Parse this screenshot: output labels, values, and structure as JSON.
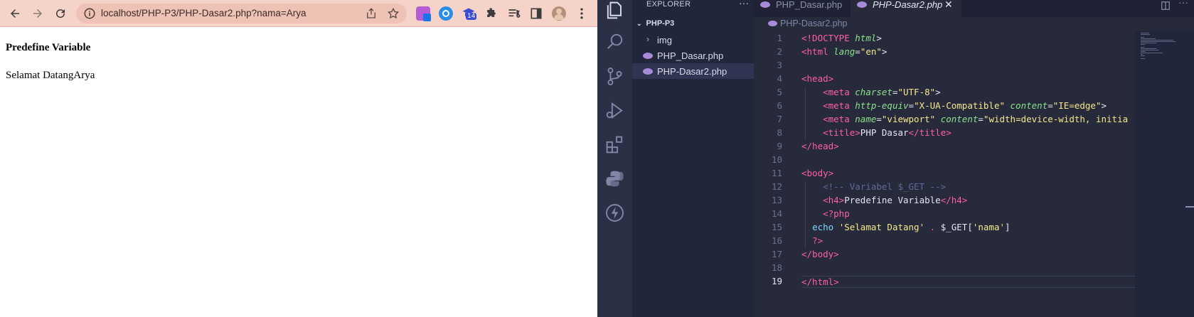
{
  "browser": {
    "url": "localhost/PHP-P3/PHP-Dasar2.php?nama=Arya",
    "ext_badge": "14",
    "page": {
      "heading": "Predefine Variable",
      "text": "Selamat DatangArya"
    },
    "icons": [
      "back-arrow-icon",
      "forward-arrow-icon",
      "reload-icon",
      "info-icon",
      "share-icon",
      "star-icon",
      "extension-icon",
      "puzzle-icon",
      "media-icon",
      "sidepanel-icon",
      "avatar",
      "menu-icon"
    ]
  },
  "vscode": {
    "explorer_title": "EXPLORER",
    "explorer_more": "···",
    "project": "PHP-P3",
    "tree": [
      {
        "label": "img",
        "type": "folder"
      },
      {
        "label": "PHP_Dasar.php",
        "type": "file"
      },
      {
        "label": "PHP-Dasar2.php",
        "type": "file"
      }
    ],
    "tabs": [
      {
        "label": "PHP_Dasar.php",
        "active": false
      },
      {
        "label": "PHP-Dasar2.php",
        "active": true
      }
    ],
    "close_glyph": "✕",
    "breadcrumb": "PHP-Dasar2.php",
    "current_line": 19,
    "line_numbers": [
      "1",
      "2",
      "3",
      "4",
      "5",
      "6",
      "7",
      "8",
      "9",
      "10",
      "11",
      "12",
      "13",
      "14",
      "15",
      "16",
      "17",
      "18",
      "19"
    ],
    "code_lines": [
      [
        {
          "t": "<!DOCTYPE ",
          "c": "tag"
        },
        {
          "t": "html",
          "c": "attr"
        },
        {
          "t": ">",
          "c": "punc"
        }
      ],
      [
        {
          "t": "<html ",
          "c": "tag"
        },
        {
          "t": "lang",
          "c": "attr"
        },
        {
          "t": "=",
          "c": "punc"
        },
        {
          "t": "\"en\"",
          "c": "str"
        },
        {
          "t": ">",
          "c": "punc"
        }
      ],
      [],
      [
        {
          "t": "<head>",
          "c": "tag"
        }
      ],
      [
        {
          "t": "    "
        },
        {
          "t": "<meta ",
          "c": "tag"
        },
        {
          "t": "charset",
          "c": "attr"
        },
        {
          "t": "=",
          "c": "punc"
        },
        {
          "t": "\"UTF-8\"",
          "c": "str"
        },
        {
          "t": ">",
          "c": "punc"
        }
      ],
      [
        {
          "t": "    "
        },
        {
          "t": "<meta ",
          "c": "tag"
        },
        {
          "t": "http-equiv",
          "c": "attr"
        },
        {
          "t": "=",
          "c": "punc"
        },
        {
          "t": "\"X-UA-Compatible\"",
          "c": "str"
        },
        {
          "t": " "
        },
        {
          "t": "content",
          "c": "attr"
        },
        {
          "t": "=",
          "c": "punc"
        },
        {
          "t": "\"IE=edge\"",
          "c": "str"
        },
        {
          "t": ">",
          "c": "punc"
        }
      ],
      [
        {
          "t": "    "
        },
        {
          "t": "<meta ",
          "c": "tag"
        },
        {
          "t": "name",
          "c": "attr"
        },
        {
          "t": "=",
          "c": "punc"
        },
        {
          "t": "\"viewport\"",
          "c": "str"
        },
        {
          "t": " "
        },
        {
          "t": "content",
          "c": "attr"
        },
        {
          "t": "=",
          "c": "punc"
        },
        {
          "t": "\"width=device-width, initia",
          "c": "str"
        }
      ],
      [
        {
          "t": "    "
        },
        {
          "t": "<title>",
          "c": "tag"
        },
        {
          "t": "PHP Dasar",
          "c": "punc"
        },
        {
          "t": "</title>",
          "c": "tag"
        }
      ],
      [
        {
          "t": "</head>",
          "c": "tag"
        }
      ],
      [],
      [
        {
          "t": "<body>",
          "c": "tag"
        }
      ],
      [
        {
          "t": "    "
        },
        {
          "t": "<!-- Variabel $_GET -->",
          "c": "com"
        }
      ],
      [
        {
          "t": "    "
        },
        {
          "t": "<h4>",
          "c": "tag"
        },
        {
          "t": "Predefine Variable",
          "c": "punc"
        },
        {
          "t": "</h4>",
          "c": "tag"
        }
      ],
      [
        {
          "t": "    "
        },
        {
          "t": "<?php",
          "c": "tag"
        }
      ],
      [
        {
          "t": "  "
        },
        {
          "t": "echo ",
          "c": "kw"
        },
        {
          "t": "'Selamat Datang'",
          "c": "str"
        },
        {
          "t": " . ",
          "c": "op"
        },
        {
          "t": "$_GET",
          "c": "var"
        },
        {
          "t": "[",
          "c": "punc"
        },
        {
          "t": "'nama'",
          "c": "str"
        },
        {
          "t": "]",
          "c": "punc"
        }
      ],
      [
        {
          "t": "  "
        },
        {
          "t": "?>",
          "c": "tag"
        }
      ],
      [
        {
          "t": "</body>",
          "c": "tag"
        }
      ],
      [],
      [
        {
          "t": "</html>",
          "c": "tag"
        }
      ]
    ],
    "colors": {
      "editor_bg": "#262a3b",
      "tag": "#ff5fa2",
      "attr": "#8be28b",
      "string": "#f7e78a",
      "comment": "#5f6a9a",
      "keyword": "#7fd7ff"
    }
  }
}
